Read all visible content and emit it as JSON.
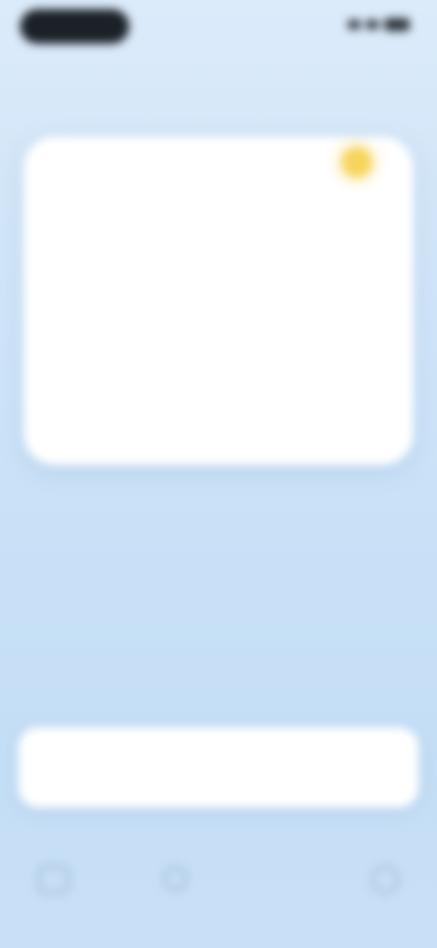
{
  "status_bar": {
    "left_text": "",
    "right_text": ""
  },
  "card": {
    "hint": "",
    "title": "",
    "subtitle": "",
    "line1": "",
    "line2": ""
  },
  "action_button": {
    "label": ""
  },
  "bottom_nav": {
    "center_label": ""
  },
  "colors": {
    "background": "#c9e1f7",
    "card": "#ffffff",
    "accent": "#4c8bd0",
    "sun": "#f7d45a"
  },
  "icons": [
    "sun-icon",
    "nav-left-icon",
    "nav-center-icon",
    "nav-right-icon"
  ]
}
